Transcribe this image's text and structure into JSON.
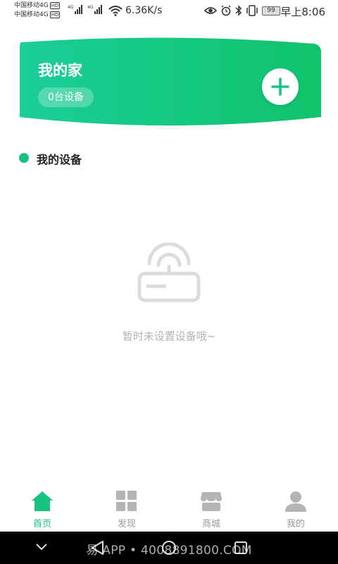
{
  "status_bar": {
    "carrier1": "中国移动4G",
    "carrier2": "中国移动4G",
    "hd_badge": "HD",
    "network_type": "4G",
    "speed": "6.36K/s",
    "battery": "99",
    "time": "早上8:06",
    "icons": [
      "eye-icon",
      "alarm-icon",
      "bluetooth-icon",
      "vibrate-icon",
      "battery-icon",
      "wifi-icon",
      "signal-icon"
    ]
  },
  "home_card": {
    "title": "我的家",
    "device_count": "0台设备",
    "add_icon": "plus-icon",
    "gradient_start": "#1ccd9a",
    "gradient_end": "#0fc46a"
  },
  "section": {
    "title": "我的设备"
  },
  "empty_state": {
    "icon": "router-icon",
    "text": "暂时未设置设备哦~"
  },
  "tabbar": {
    "accent": "#16c47f",
    "inactive_color": "#b5b5b5",
    "items": [
      {
        "label": "首页",
        "icon": "home-icon",
        "active": true
      },
      {
        "label": "发现",
        "icon": "grid-icon",
        "active": false
      },
      {
        "label": "商城",
        "icon": "store-icon",
        "active": false
      },
      {
        "label": "我的",
        "icon": "user-icon",
        "active": false
      }
    ]
  },
  "navbar": {
    "items": [
      "collapse-icon",
      "back-icon",
      "home-circle-icon",
      "recents-icon"
    ],
    "watermark": "易 APP • 4008891800.COM"
  }
}
